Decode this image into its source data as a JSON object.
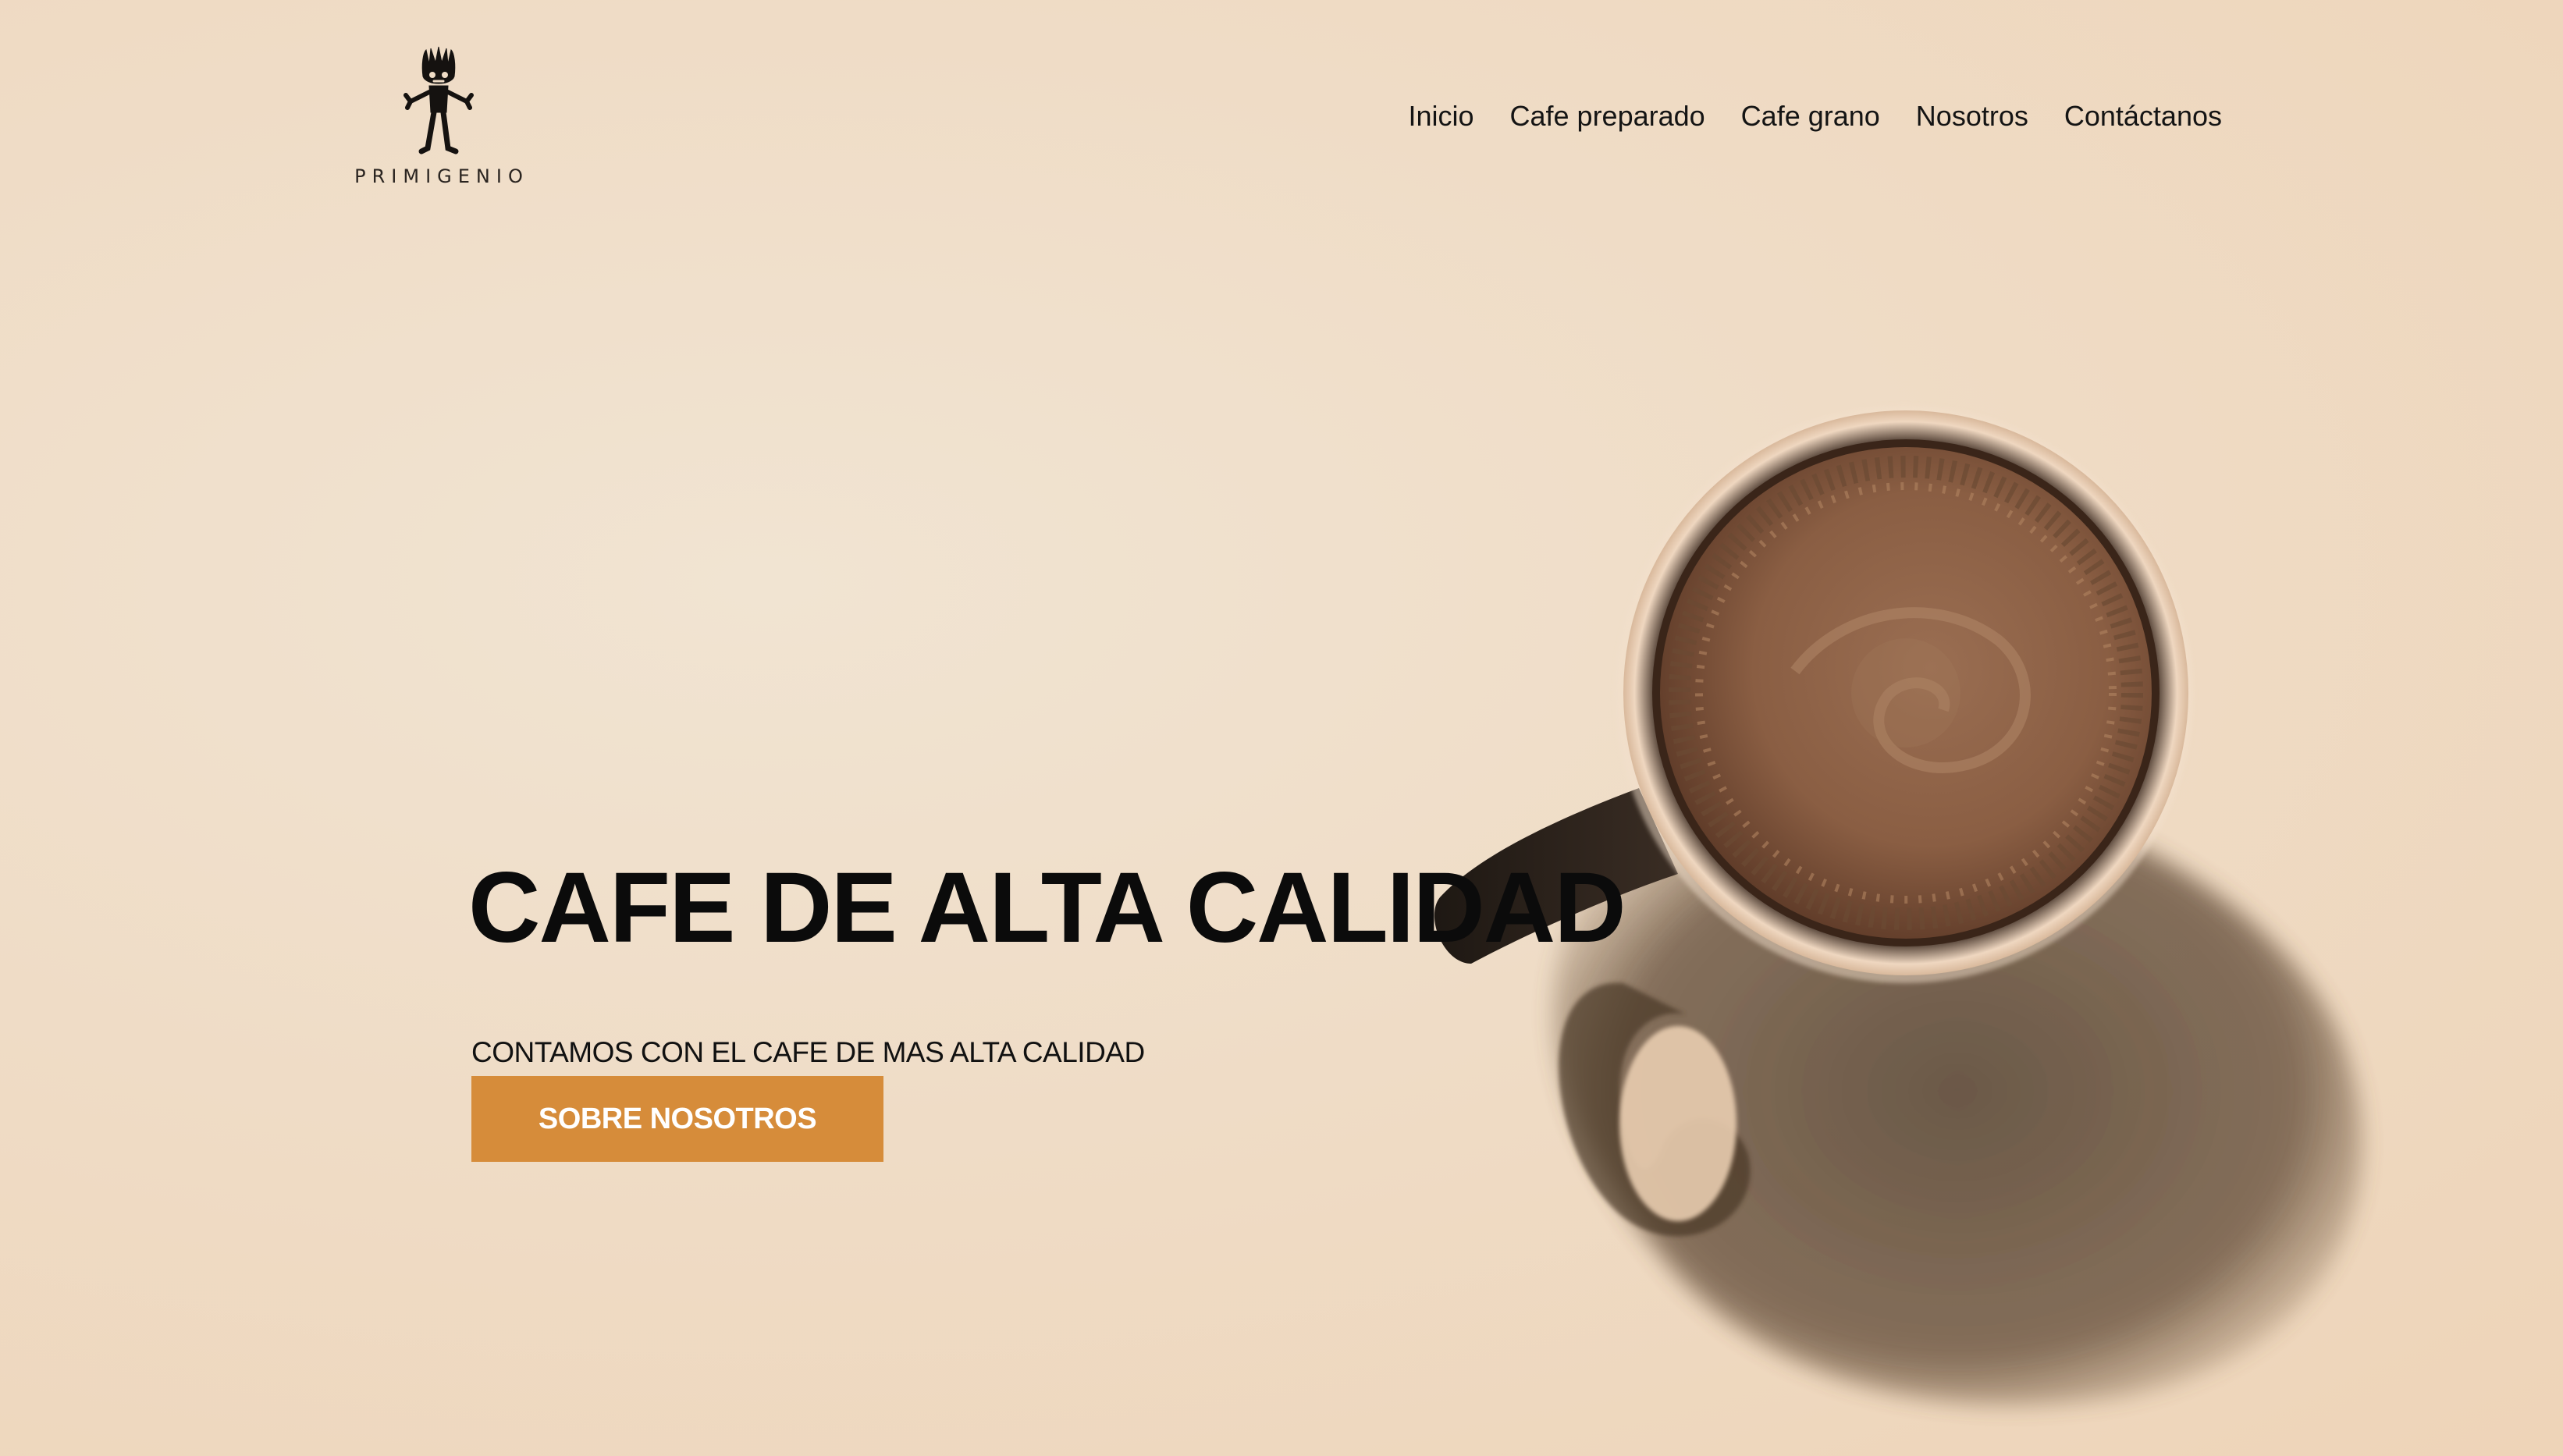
{
  "brand": {
    "name": "PRIMIGENIO",
    "logo_icon": "tribal-figure-logo"
  },
  "nav": {
    "items": [
      {
        "label": "Inicio"
      },
      {
        "label": "Cafe preparado"
      },
      {
        "label": "Cafe grano"
      },
      {
        "label": "Nosotros"
      },
      {
        "label": "Contáctanos"
      }
    ]
  },
  "hero": {
    "title": "CAFE DE ALTA CALIDAD",
    "subtitle": "CONTAMOS CON EL CAFE DE MAS ALTA CALIDAD",
    "cta_label": "SOBRE NOSOTROS",
    "background_image": "coffee-cup-photo"
  },
  "colors": {
    "background": "#eedcc6",
    "cta": "#d68c3a",
    "text": "#0b0b0b"
  }
}
